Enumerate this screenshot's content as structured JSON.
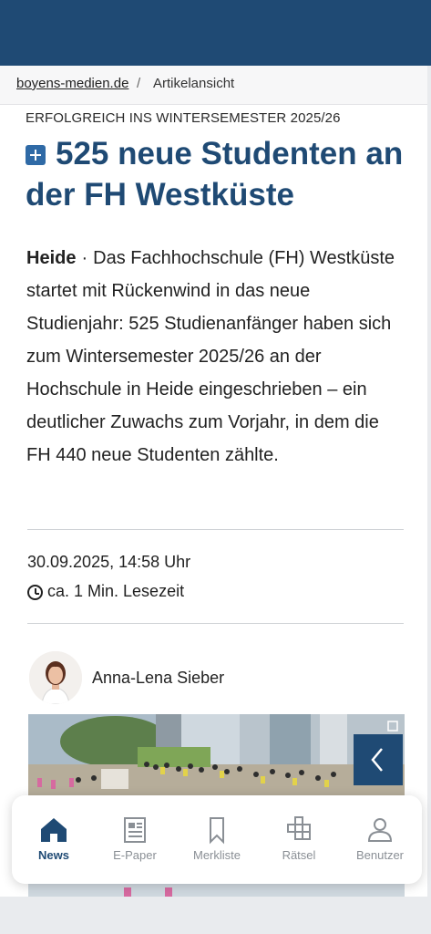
{
  "breadcrumb": {
    "home": "boyens-medien.de",
    "separator": "/",
    "current": "Artikelansicht"
  },
  "article": {
    "kicker": "ERFOLGREICH INS WINTERSEMESTER 2025/26",
    "headline": "525 neue Studenten an der FH Westküste",
    "place": "Heide",
    "dot": "·",
    "lead": "Das Fachhochschule (FH) Westküste startet mit Rückenwind in das neue Studienjahr: 525 Studienanfänger haben sich zum Wintersemester 2025/26 an der Hochschule in Heide eingeschrieben – ein deutlicher Zuwachs zum Vorjahr, in dem die FH 440 neue Studenten zählte.",
    "date": "30.09.2025, 14:58 Uhr",
    "readtime": "ca. 1 Min. Lesezeit",
    "author": "Anna-Lena Sieber"
  },
  "nav": {
    "items": [
      {
        "label": "News",
        "icon": "home-icon",
        "active": true
      },
      {
        "label": "E-Paper",
        "icon": "newspaper-icon",
        "active": false
      },
      {
        "label": "Merkliste",
        "icon": "bookmark-icon",
        "active": false
      },
      {
        "label": "Rätsel",
        "icon": "crossword-icon",
        "active": false
      },
      {
        "label": "Benutzer",
        "icon": "user-icon",
        "active": false
      }
    ]
  },
  "colors": {
    "brand": "#1f4a74",
    "accent": "#2f6aa6",
    "inactive": "#8a8f95"
  }
}
